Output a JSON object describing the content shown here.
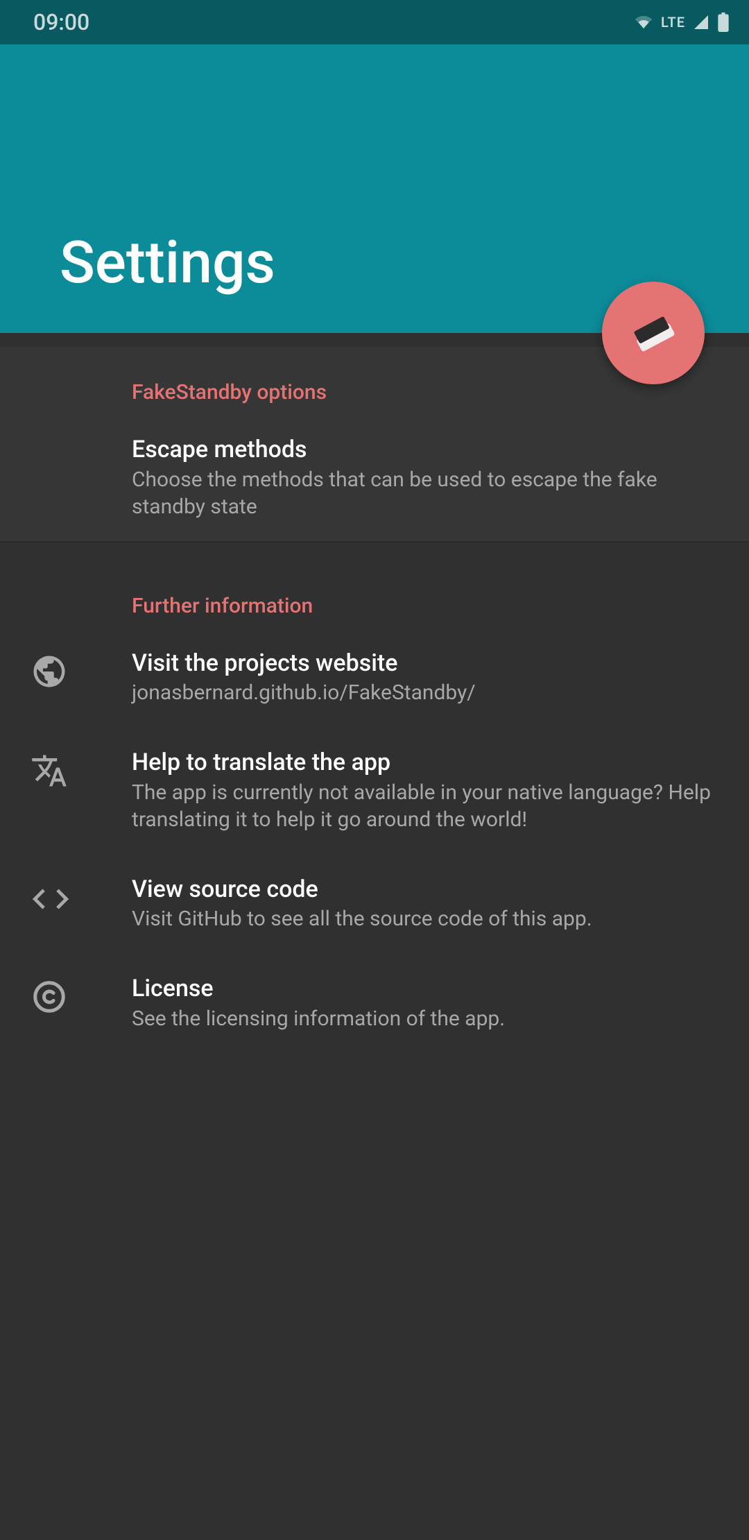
{
  "status": {
    "time": "09:00",
    "lte": "LTE"
  },
  "header": {
    "title": "Settings"
  },
  "sections": {
    "options": {
      "header": "FakeStandby options",
      "escapeTitle": "Escape methods",
      "escapeSub": "Choose the methods that can be used to escape the fake standby state"
    },
    "info": {
      "header": "Further information",
      "websiteTitle": "Visit the projects website",
      "websiteSub": "jonasbernard.github.io/FakeStandby/",
      "translateTitle": "Help to translate the app",
      "translateSub": "The app is currently not available in your native language? Help translating it to help it go around the world!",
      "sourceTitle": "View source code",
      "sourceSub": "Visit GitHub to see all the source code of this app.",
      "licenseTitle": "License",
      "licenseSub": "See the licensing information of the app."
    }
  }
}
